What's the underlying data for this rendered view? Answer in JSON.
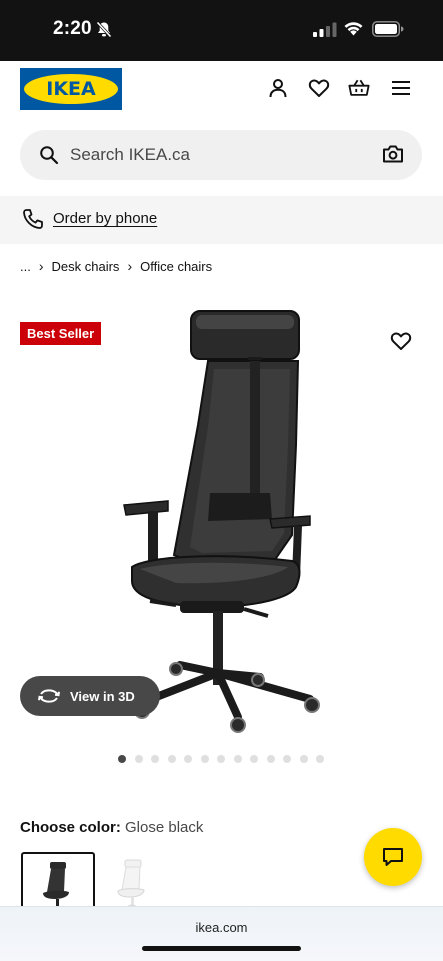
{
  "status_bar": {
    "time": "2:20"
  },
  "header": {
    "logo_text": "IKEA",
    "brand_colors": {
      "blue": "#0058a3",
      "yellow": "#ffdb00"
    },
    "icons": [
      "profile-icon",
      "heart-icon",
      "basket-icon",
      "menu-icon"
    ]
  },
  "search": {
    "placeholder": "Search IKEA.ca"
  },
  "order_bar": {
    "label": "Order by phone"
  },
  "breadcrumb": {
    "ellipsis": "...",
    "items": [
      "Desk chairs",
      "Office chairs"
    ]
  },
  "product": {
    "badge": "Best Seller",
    "badge_color": "#cc0008",
    "view_3d_label": "View in 3D",
    "carousel": {
      "total_images": 13,
      "active_index": 0
    }
  },
  "color_chooser": {
    "label": "Choose color:",
    "selected_value": "Glose black",
    "swatches": [
      "black",
      "white"
    ],
    "selected_index": 0
  },
  "browser": {
    "url": "ikea.com"
  }
}
